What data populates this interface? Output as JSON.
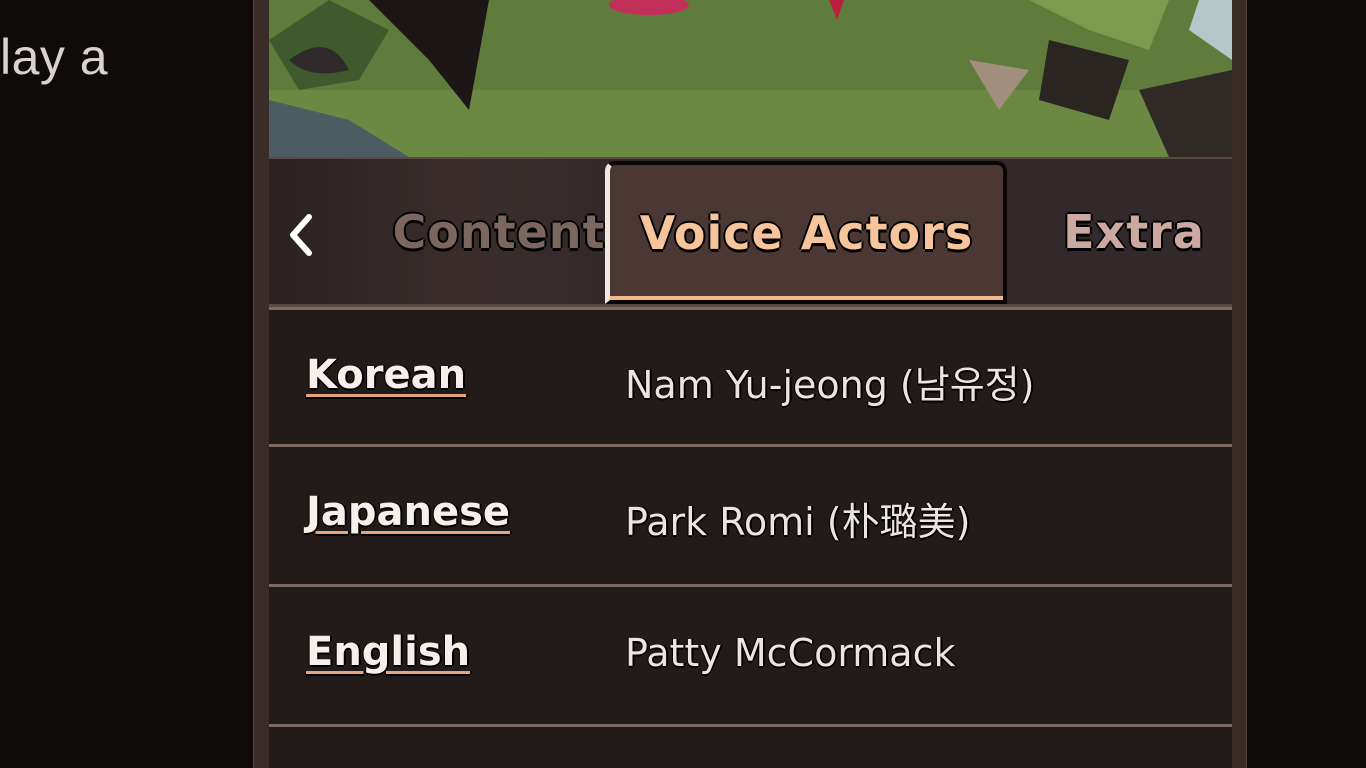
{
  "background_text": "lay a",
  "tabs": {
    "prev_icon": "chevron-left-icon",
    "items": [
      {
        "label": "Content"
      },
      {
        "label": "Voice Actors"
      },
      {
        "label": "Extra"
      }
    ],
    "active": "Voice Actors"
  },
  "voice_actors": [
    {
      "language": "Korean",
      "actor": "Nam Yu-jeong (남유정)"
    },
    {
      "language": "Japanese",
      "actor": "Park Romi (朴璐美)"
    },
    {
      "language": "English",
      "actor": "Patty McCormack"
    }
  ],
  "colors": {
    "active_tab_text": "#f7c49b",
    "accent_underline": "#e5a47a",
    "panel_bg": "#221b1a"
  }
}
